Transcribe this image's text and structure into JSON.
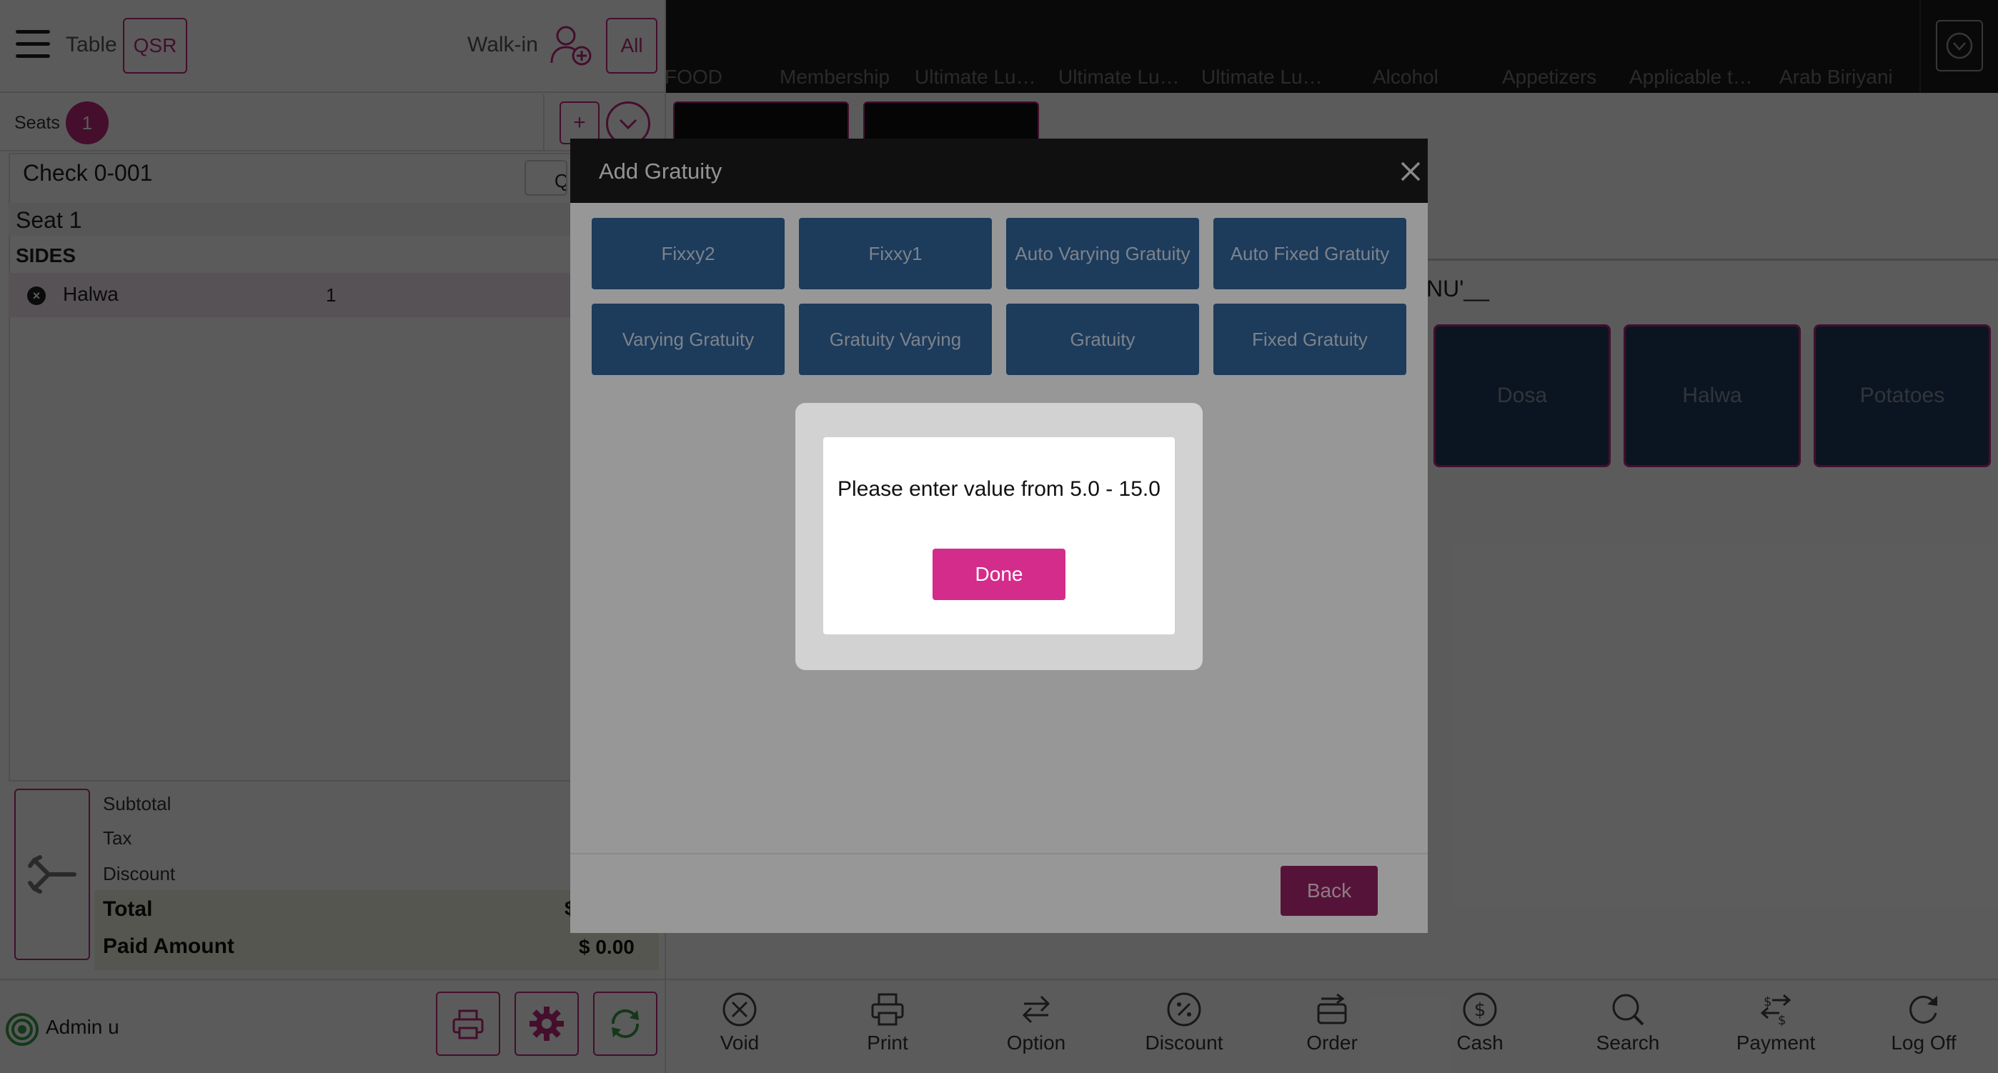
{
  "header": {
    "table_label": "Table",
    "qsr_label": "QSR",
    "walkin_label": "Walk-in",
    "all_label": "All"
  },
  "seats": {
    "label": "Seats",
    "count": "1",
    "add_label": "+"
  },
  "check": {
    "title": "Check 0-001",
    "q_button": "Q",
    "seat_label": "Seat 1",
    "section_label": "SIDES",
    "items": [
      {
        "name": "Halwa",
        "qty": "1"
      }
    ]
  },
  "totals": {
    "subtotal_label": "Subtotal",
    "tax_label": "Tax",
    "discount_label": "Discount",
    "total_label": "Total",
    "total_value": "$",
    "paid_label": "Paid Amount",
    "paid_value": "$ 0.00"
  },
  "footer_left": {
    "user_label": "Admin u"
  },
  "categories": [
    "FOOD",
    "Membership",
    "Ultimate Lu…",
    "Ultimate Lu…",
    "Ultimate Lu…",
    "Alcohol",
    "Appetizers",
    "Applicable t…",
    "Arab Biriyani"
  ],
  "menu": {
    "section_label": "NU'__",
    "items": [
      "Dosa",
      "Halwa",
      "Potatoes"
    ]
  },
  "toolbar": {
    "items": [
      "Void",
      "Print",
      "Option",
      "Discount",
      "Order",
      "Cash",
      "Search",
      "Payment",
      "Log Off"
    ]
  },
  "gratuity_dialog": {
    "title": "Add Gratuity",
    "options": [
      "Fixxy2",
      "Fixxy1",
      "Auto Varying Gratuity",
      "Auto Fixed Gratuity",
      "Varying Gratuity",
      "Gratuity Varying",
      "Gratuity",
      "Fixed Gratuity"
    ],
    "back_label": "Back"
  },
  "alert": {
    "message": "Please enter value from 5.0 - 15.0",
    "done_label": "Done"
  },
  "colors": {
    "accent": "#c02a7d",
    "done_button": "#d42c8b",
    "tile_blue": "#2f5f94",
    "category_bar": "#1a1a1a"
  }
}
